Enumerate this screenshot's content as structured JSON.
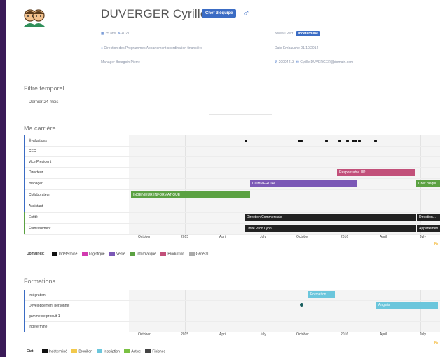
{
  "header": {
    "name": "DUVERGER Cyrille",
    "role_badge": "Chef d'équipe",
    "age": "25 ans",
    "id": "4021",
    "niveau_label": "Niveau Perf.",
    "niveau_value": "Indéterminé",
    "direction": "Direction des Programmes  Appartement coordination financière",
    "embauche": "Date Embauche 01/10/2014",
    "manager": "Manager Bourgoin Pierre",
    "phone": "20004413",
    "email": "Cyrille.DUVERGER@domain.com"
  },
  "filter": {
    "title": "Filtre temporel",
    "value": "Dernier 24 mois"
  },
  "career": {
    "title": "Ma carrière",
    "rows": [
      "Évaluations",
      "CEO",
      "Vice President",
      "Directeur",
      "manager",
      "Collaborateur",
      "Assistant",
      "Entité",
      "Établissement"
    ],
    "bars": [
      {
        "label": "Responsable UP",
        "color": "#c2507a"
      },
      {
        "label": "COMMERCIAL",
        "color": "#7b58b6"
      },
      {
        "label": "Chef d'équi...",
        "color": "#5ba142"
      },
      {
        "label": "INGENIEUR INFORMATIQUE",
        "color": "#5ba142"
      },
      {
        "label": "Direction Commerciale",
        "color": "#222222"
      },
      {
        "label": "Direction...",
        "color": "#222222"
      },
      {
        "label": "Unité Prod Lyon",
        "color": "#222222"
      },
      {
        "label": "Appartemen...",
        "color": "#222222"
      }
    ],
    "axis": [
      "October",
      "2015",
      "April",
      "July",
      "October",
      "2016",
      "April",
      "July"
    ],
    "legend_title": "Domaines:",
    "legend": [
      {
        "label": "Indéterminé",
        "color": "#111111"
      },
      {
        "label": "Logistique",
        "color": "#d23bb0"
      },
      {
        "label": "Vente",
        "color": "#7b58b6"
      },
      {
        "label": "Informatique",
        "color": "#5ba142"
      },
      {
        "label": "Production",
        "color": "#c2507a"
      },
      {
        "label": "Général",
        "color": "#aaaaaa"
      }
    ],
    "extra_label": "Fin"
  },
  "formations": {
    "title": "Formations",
    "rows": [
      "Intégration",
      "Développement personnel",
      "gamme de produit 1",
      "Indéterminé"
    ],
    "bars": [
      {
        "label": "Formation",
        "color": "#6bc6dc"
      },
      {
        "label": "Anglais",
        "color": "#6bc6dc"
      }
    ],
    "axis": [
      "October",
      "2015",
      "April",
      "July",
      "October",
      "2016",
      "April",
      "July"
    ],
    "legend_title": "Etat:",
    "legend": [
      {
        "label": "Indéterminé",
        "color": "#111111"
      },
      {
        "label": "Brouillon",
        "color": "#f2c94c"
      },
      {
        "label": "Inscription",
        "color": "#6bc6dc"
      },
      {
        "label": "Active",
        "color": "#7ac143"
      },
      {
        "label": "Finished",
        "color": "#444444"
      }
    ],
    "extra_label": "Fin"
  },
  "colors": {
    "accent": "#3b6cc4",
    "sidebar": "#3a1a57"
  }
}
